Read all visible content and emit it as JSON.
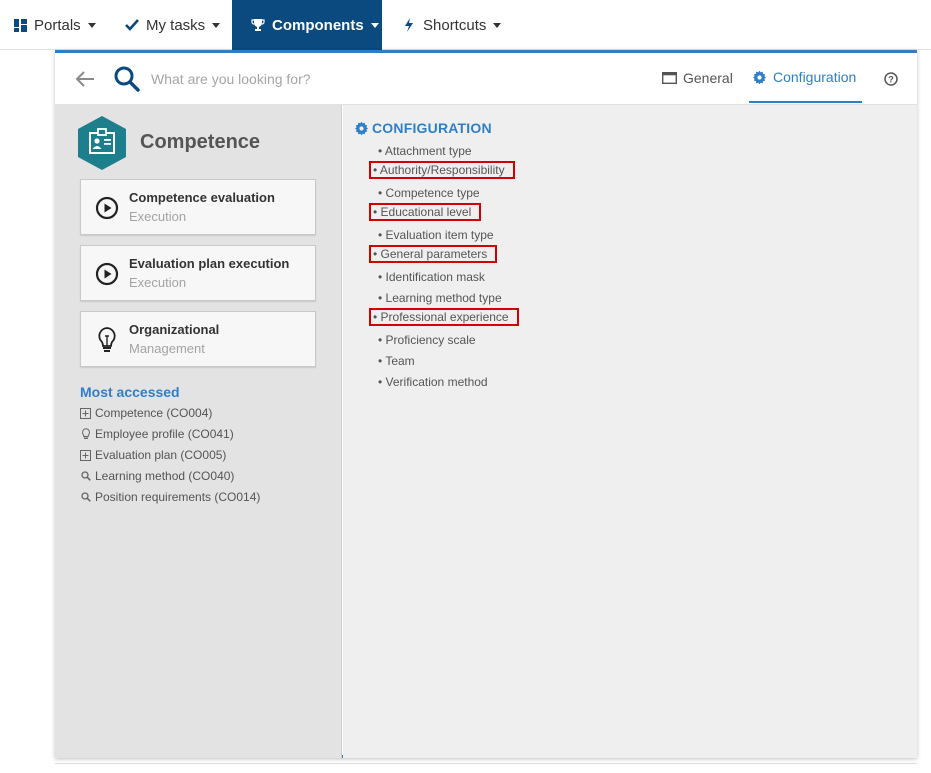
{
  "topnav": {
    "items": [
      {
        "label": "Portals",
        "icon": "dashboard-icon"
      },
      {
        "label": "My tasks",
        "icon": "check-icon"
      },
      {
        "label": "Components",
        "icon": "trophy-icon",
        "active": true
      },
      {
        "label": "Shortcuts",
        "icon": "lightning-icon"
      }
    ],
    "active_color": "#0b4a7e"
  },
  "search": {
    "placeholder": "What are you looking for?"
  },
  "tabs": [
    {
      "label": "General",
      "icon": "window-icon"
    },
    {
      "label": "Configuration",
      "icon": "gear-icon",
      "active": true
    }
  ],
  "sidebar": {
    "title": "Competence",
    "logo_icon": "badge-icon",
    "cards": [
      {
        "title": "Competence evaluation",
        "subtitle": "Execution",
        "icon": "play-circle-icon"
      },
      {
        "title": "Evaluation plan execution",
        "subtitle": "Execution",
        "icon": "play-circle-icon"
      },
      {
        "title": "Organizational",
        "subtitle": "Management",
        "icon": "lightbulb-icon"
      }
    ],
    "most_accessed": {
      "title": "Most accessed",
      "items": [
        {
          "label": "Competence (CO004)",
          "icon": "plus-square-icon"
        },
        {
          "label": "Employee profile (CO041)",
          "icon": "lightbulb-icon"
        },
        {
          "label": "Evaluation plan (CO005)",
          "icon": "plus-square-icon"
        },
        {
          "label": "Learning method (CO040)",
          "icon": "search-icon"
        },
        {
          "label": "Position requirements (CO014)",
          "icon": "search-icon"
        }
      ]
    }
  },
  "configuration": {
    "title": "CONFIGURATION",
    "items": [
      {
        "label": "• Attachment type",
        "highlighted": false
      },
      {
        "label": "• Authority/Responsibility",
        "highlighted": true
      },
      {
        "label": "• Competence type",
        "highlighted": false
      },
      {
        "label": "• Educational level",
        "highlighted": true
      },
      {
        "label": "• Evaluation item type",
        "highlighted": false
      },
      {
        "label": "• General parameters",
        "highlighted": true
      },
      {
        "label": "• Identification mask",
        "highlighted": false
      },
      {
        "label": "• Learning method type",
        "highlighted": false
      },
      {
        "label": "• Professional experience",
        "highlighted": true
      },
      {
        "label": "• Proficiency scale",
        "highlighted": false
      },
      {
        "label": "• Team",
        "highlighted": false
      },
      {
        "label": "• Verification method",
        "highlighted": false
      }
    ],
    "highlight_color": "#d40000"
  },
  "colors": {
    "accent": "#2f7fc8",
    "logo_teal": "#1d7f8c"
  }
}
